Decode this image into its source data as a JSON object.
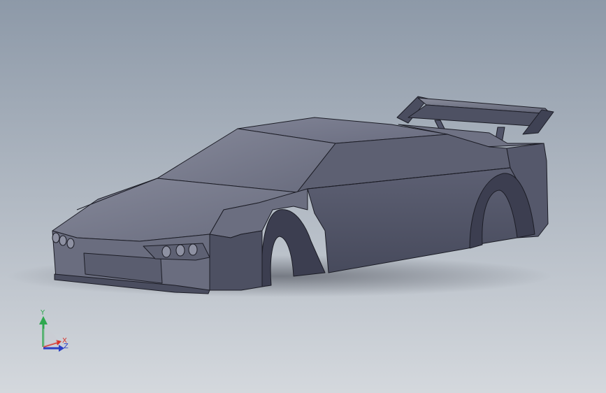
{
  "viewport": {
    "background_top": "#8d99a8",
    "background_bottom": "#d4d8dd"
  },
  "model": {
    "body_color": "#5b5d6e",
    "body_light": "#7d8092",
    "body_dark": "#44465a",
    "edge_color": "#1c1d26"
  },
  "triad": {
    "y_label": "Y",
    "x_label": "X",
    "z_label": "Z",
    "y_color": "#2fa84f",
    "x_color": "#d8332b",
    "z_color": "#2b3fc4"
  }
}
